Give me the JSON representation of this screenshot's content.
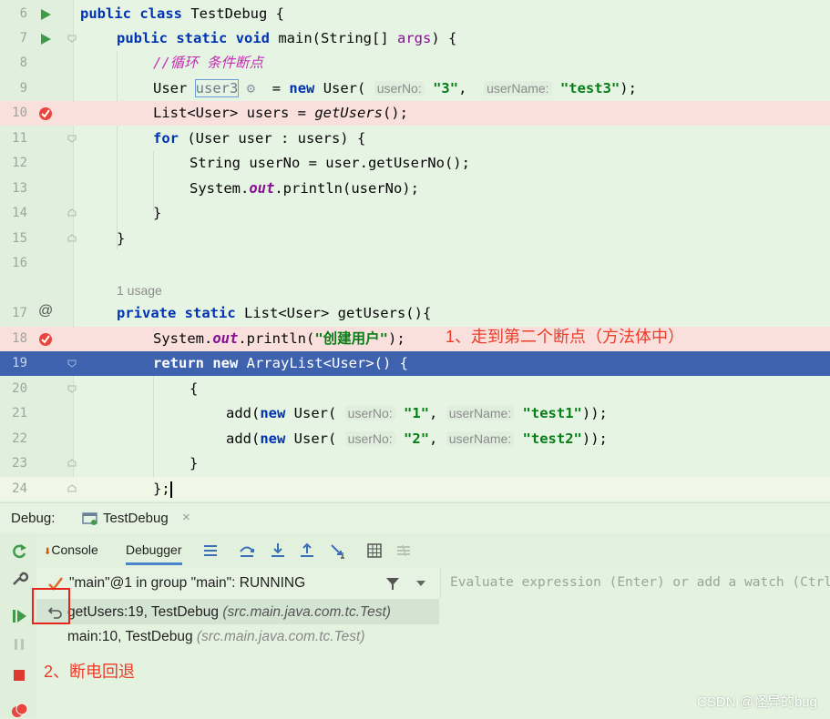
{
  "editor": {
    "lines": [
      {
        "num": "6"
      },
      {
        "num": "7"
      },
      {
        "num": "8"
      },
      {
        "num": "9"
      },
      {
        "num": "10"
      },
      {
        "num": "11"
      },
      {
        "num": "12"
      },
      {
        "num": "13"
      },
      {
        "num": "14"
      },
      {
        "num": "15"
      },
      {
        "num": "16"
      },
      {
        "num": "17"
      },
      {
        "num": "18"
      },
      {
        "num": "19"
      },
      {
        "num": "20"
      },
      {
        "num": "21"
      },
      {
        "num": "22"
      },
      {
        "num": "23"
      },
      {
        "num": "24"
      }
    ],
    "tok": {
      "public": "public",
      "class": "class",
      "static": "static",
      "void": "void",
      "new": "new",
      "for": "for",
      "private": "private",
      "return": "return",
      "class_name": " TestDebug {",
      "main_sig": " main(String[] ",
      "args": "args",
      "main_end": ") {",
      "comment": "//循环 条件断点",
      "user_type": "User ",
      "user3": "user3",
      "eq_new": "  = ",
      "user_ctor": " User(",
      "hint_userNo": "userNo:",
      "hint_userName": "userName:",
      "str_3": "\"3\"",
      "str_test3": "\"test3\"",
      "str_1": "\"1\"",
      "str_test1": "\"test1\"",
      "str_2": "\"2\"",
      "str_test2": "\"test2\"",
      "comma": ", ",
      "close_semi": ");",
      "close_close": "));",
      "list_users": "List<User> users = ",
      "getUsers_call": "getUsers",
      "parens_semi": "();",
      "for_rest": " (User user : users) {",
      "string_userNo": "String userNo = user.getUserNo();",
      "system": "System.",
      "out": "out",
      "println_userNo": ".println(userNo);",
      "close_brace": "}",
      "open_brace": "{",
      "usage": "1 usage",
      "get_users_sig": " List<User> getUsers(){",
      "println_open": ".println(",
      "str_create": "\"创建用户\"",
      "return_rest": " ArrayList<User>() {",
      "add_new": "add(",
      "brace_semi": "};"
    }
  },
  "annotations": {
    "step1": "1、走到第二个断点（方法体中）",
    "step2": "2、断电回退"
  },
  "debug": {
    "label": "Debug:",
    "session_tab": "TestDebug",
    "close": "×",
    "tabs": {
      "console": "Console",
      "debugger": "Debugger"
    },
    "thread": "\"main\"@1 in group \"main\": RUNNING",
    "frames": [
      {
        "method": "getUsers:19, TestDebug ",
        "pkg": "(src.main.java.com.tc.Test)"
      },
      {
        "method": "main:10, TestDebug ",
        "pkg": "(src.main.java.com.tc.Test)"
      }
    ],
    "eval_placeholder": "Evaluate expression (Enter) or add a watch (Ctrl+Shift+Enter)"
  },
  "watermark": "CSDN @怪异的bug",
  "colors": {
    "breakpoint": "#e8463e",
    "exec_line": "#3e62ad",
    "accent": "#4a85cc",
    "annotation": "#ec3b28"
  }
}
